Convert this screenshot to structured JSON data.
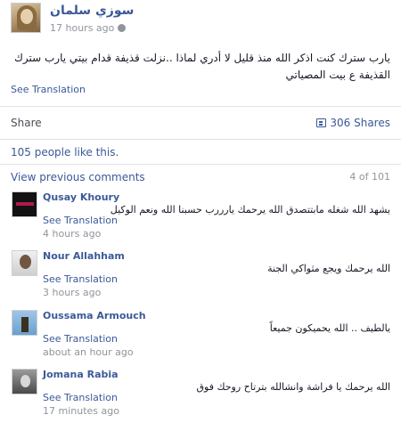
{
  "post": {
    "author": "سوزي سلمان",
    "time": "17 hours ago",
    "text": "يارب سترك كنت اذكر الله منذ قليل لا أدري لماذا ..نزلت قذيفة قدام بيتي يارب سترك القذيفة ع بيت المصياتي",
    "see_translation": "See Translation"
  },
  "actions": {
    "share_label": "Share",
    "shares_count": "306 Shares"
  },
  "likes": "105 people like this.",
  "comments_nav": {
    "view_previous": "View previous comments",
    "count": "4 of 101"
  },
  "comments": [
    {
      "name": "Qusay Khoury",
      "text": "يشهد الله شغله مابتتصدق الله يرحمك يارررب حسبنا الله ونعم الوكيل",
      "translate": "See Translation",
      "time": "4 hours ago"
    },
    {
      "name": "Nour Allahham",
      "text": "الله يرحمك ويجع مثواكي الجنة",
      "translate": "See Translation",
      "time": "3 hours ago"
    },
    {
      "name": "Oussama Armouch",
      "text": "يالطيف .. الله يحميكون جميعاً",
      "translate": "See Translation",
      "time": "about an hour ago"
    },
    {
      "name": "Jomana Rabia",
      "text": "الله يرحمك يا فراشة وانشالله بترتاح روحك فوق",
      "translate": "See Translation",
      "time": "17 minutes ago"
    }
  ],
  "colors": {
    "link": "#3b5998",
    "muted": "#90949c",
    "divider": "#e1e2e3"
  }
}
